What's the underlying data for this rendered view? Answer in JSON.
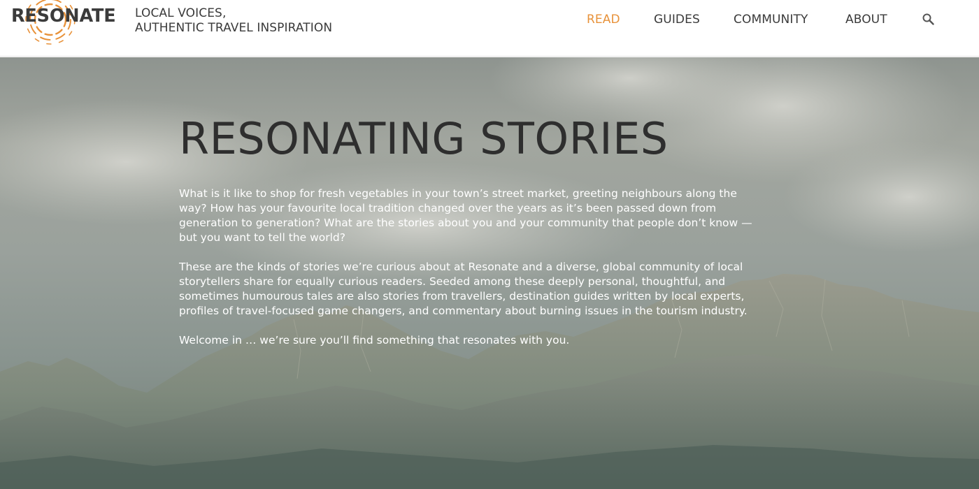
{
  "brand": {
    "logo_text": "RESONATE",
    "accent_color": "#e8923a",
    "tagline_line1": "LOCAL VOICES,",
    "tagline_line2": "AUTHENTIC TRAVEL INSPIRATION"
  },
  "nav": {
    "items": [
      {
        "label": "READ",
        "active": true
      },
      {
        "label": "GUIDES",
        "active": false
      },
      {
        "label": "COMMUNITY",
        "active": false
      },
      {
        "label": "ABOUT",
        "active": false
      }
    ],
    "search_icon": "search-icon"
  },
  "hero": {
    "title": "RESONATING STORIES",
    "paragraphs": [
      "What is it like to shop for fresh vegetables in your town’s street market, greeting neighbours along the way? How has your favourite local tradition changed over the years as it’s been passed down from generation to generation? What are the stories about you and your community that people don’t know — but you want to tell the world?",
      "These are the kinds of stories we’re curious about at Resonate and a diverse, global community of local storytellers share for equally curious readers. Seeded among these deeply personal, thoughtful, and sometimes humourous tales are also stories from travellers, destination guides written by local experts, profiles of travel-focused game changers, and commentary about burning issues in the tourism industry.",
      "Welcome in … we’re sure you’ll find something that resonates with you."
    ]
  }
}
